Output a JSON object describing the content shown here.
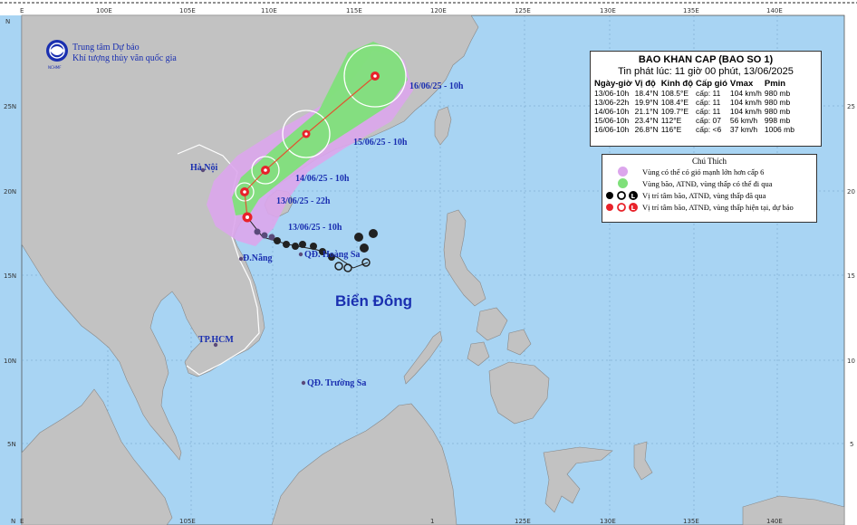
{
  "agency": {
    "line1": "Trung tâm Dự báo",
    "line2": "Khí tượng thủy văn quốc gia",
    "logo_text": "NCHMF"
  },
  "axis": {
    "top_labels": [
      "E",
      "100E",
      "105E",
      "110E",
      "115E",
      "120E",
      "125E",
      "130E",
      "135E",
      "140E"
    ],
    "bottom_labels": [
      "E",
      "105E",
      "1",
      "125E",
      "130E",
      "135E",
      "140E"
    ],
    "left_labels": [
      "N",
      "25N",
      "20N",
      "15N",
      "10N",
      "5N",
      "N"
    ],
    "right_labels": [
      "25",
      "20",
      "15",
      "10",
      "5"
    ]
  },
  "bulletin": {
    "title": "BAO KHAN CAP (BAO SO 1)",
    "issued": "Tin phát lúc: 11 giờ 00 phút, 13/06/2025",
    "headers": [
      "Ngày-giờ",
      "Vị độ",
      "Kinh độ",
      "Cấp gió",
      "Vmax",
      "Pmin"
    ],
    "rows": [
      [
        "13/06-10h",
        "18.4°N",
        "108.5°E",
        "cấp: 11",
        "104 km/h",
        "980 mb"
      ],
      [
        "13/06-22h",
        "19.9°N",
        "108.4°E",
        "cấp: 11",
        "104 km/h",
        "980 mb"
      ],
      [
        "14/06-10h",
        "21.1°N",
        "109.7°E",
        "cấp: 11",
        "104 km/h",
        "980 mb"
      ],
      [
        "15/06-10h",
        "23.4°N",
        "112°E",
        "cấp: 07",
        "56 km/h",
        "998 mb"
      ],
      [
        "16/06-10h",
        "26.8°N",
        "116°E",
        "cấp: <6",
        "37 km/h",
        "1006 mb"
      ]
    ]
  },
  "legend": {
    "title": "Chú Thích",
    "items": [
      {
        "label": "Vùng có thể có gió mạnh lớn hơn cấp 6",
        "color": "#dca6ec"
      },
      {
        "label": "Vùng bão, ATNĐ, vùng thấp có thể đi qua",
        "color": "#7fe07a"
      },
      {
        "label": "Vị trí tâm bão, ATNĐ, vùng thấp đã qua",
        "color": "#000000"
      },
      {
        "label": "Vị trí tâm bão, ATNĐ, vùng thấp hiện tại, dự báo",
        "color": "#e8222a"
      }
    ]
  },
  "forecast_labels": {
    "f1": "16/06/25 - 10h",
    "f2": "15/06/25 - 10h",
    "f3": "14/06/25 - 10h",
    "f4": "13/06/25 - 22h",
    "f5": "13/06/25 - 10h"
  },
  "places": {
    "hanoi": "Hà Nội",
    "danang": "Đ.Nẵng",
    "hoangsa": "QĐ. Hoàng Sa",
    "hcm": "TP.HCM",
    "truongsa": "QĐ. Trường Sa",
    "sea": "Biển Đông"
  },
  "colors": {
    "sea": "#a8d4f3",
    "land": "#c2c2c2",
    "wind_zone": "#dca6ec",
    "storm_zone": "#7fe07a",
    "track_red": "#e8222a",
    "text_blue": "#1a2fb0"
  }
}
